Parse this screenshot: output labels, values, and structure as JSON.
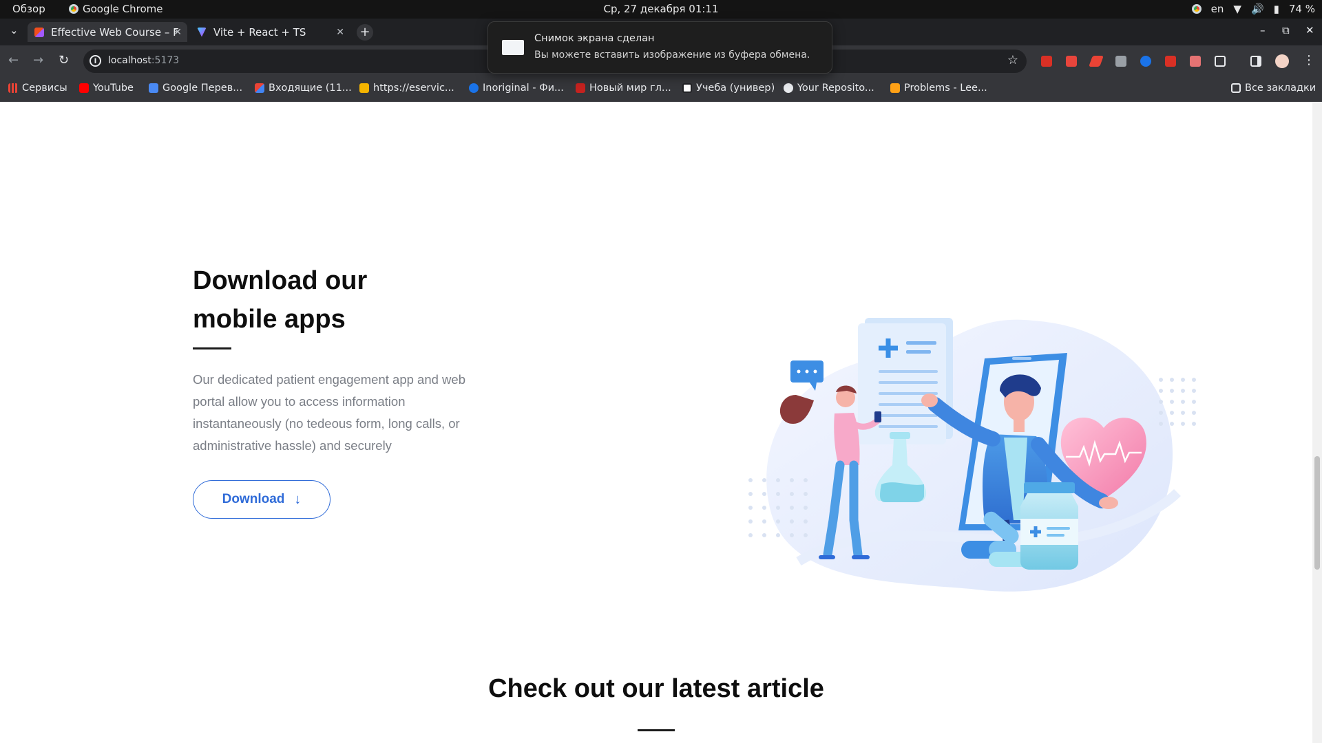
{
  "system": {
    "overview": "Обзор",
    "app_name": "Google Chrome",
    "clock": "Ср, 27 декабря  01:11",
    "lang": "en",
    "battery": "74 %"
  },
  "tabs": [
    {
      "title": "Effective Web Course – F",
      "active": true
    },
    {
      "title": "Vite + React + TS",
      "active": false
    }
  ],
  "address": {
    "host": "localhost",
    "port": ":5173"
  },
  "bookmarks": [
    {
      "label": "Сервисы",
      "color": "#e04b3a"
    },
    {
      "label": "YouTube",
      "color": "#ff0000"
    },
    {
      "label": "Google Перев...",
      "color": "#4a8af4"
    },
    {
      "label": "Входящие (11...",
      "color": "#d93025"
    },
    {
      "label": "https://eservic...",
      "color": "#f4b400"
    },
    {
      "label": "Inoriginal - Фи...",
      "color": "#1a73e8"
    },
    {
      "label": "Новый мир гл...",
      "color": "#c5221f"
    },
    {
      "label": "Учеба (универ)",
      "color": "#e8eaed"
    },
    {
      "label": "Your Reposito...",
      "color": "#e8eaed"
    },
    {
      "label": "Problems - Lee...",
      "color": "#ffa116"
    }
  ],
  "all_bookmarks": "Все закладки",
  "notification": {
    "title": "Снимок экрана сделан",
    "body": "Вы можете вставить изображение из буфера обмена."
  },
  "download_section": {
    "title_line1": "Download our",
    "title_line2": "mobile apps",
    "description": "Our dedicated patient engagement app and web portal allow you to access information instantaneously (no tedeous form, long calls, or administrative hassle) and securely",
    "button_label": "Download"
  },
  "article_section": {
    "title": "Check out our latest article"
  },
  "colors": {
    "accent": "#2f6bd8",
    "heading": "#0e0e0e",
    "body_text": "#7a7e86"
  }
}
